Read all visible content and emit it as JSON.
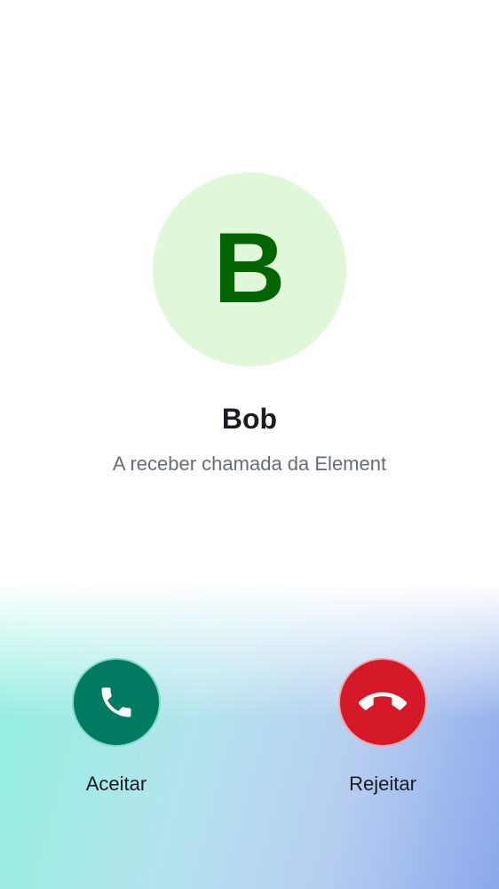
{
  "caller": {
    "initial": "B",
    "name": "Bob",
    "status": "A receber chamada da Element"
  },
  "actions": {
    "accept_label": "Aceitar",
    "reject_label": "Rejeitar"
  },
  "icons": {
    "accept": "phone-icon",
    "reject": "phone-hangup-icon"
  },
  "colors": {
    "avatar_background": "#e0f7da",
    "avatar_letter": "#006400",
    "accept_button": "#007a61",
    "accept_border": "#7fdcc4",
    "reject_button": "#d51928",
    "reject_border": "#f3a7ae",
    "icon": "#ffffff"
  }
}
